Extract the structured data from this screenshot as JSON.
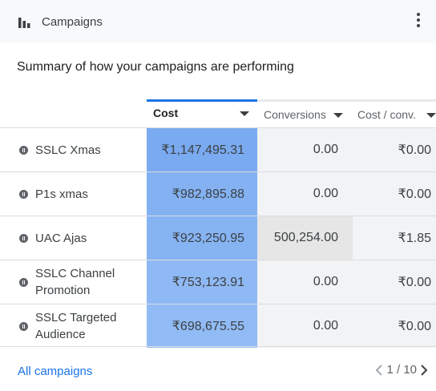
{
  "header": {
    "title": "Campaigns",
    "menu_icon": "more-vert-icon",
    "chart_icon": "bar-chart-icon"
  },
  "summary_text": "Summary of how your campaigns are performing",
  "columns": [
    {
      "label": "Cost",
      "active": true
    },
    {
      "label": "Conversions",
      "active": false
    },
    {
      "label": "Cost / conv.",
      "active": false
    }
  ],
  "rows": [
    {
      "name": "SSLC Xmas",
      "cost": "₹1,147,495.31",
      "conversions": "0.00",
      "cost_per_conv": "₹0.00",
      "status_icon": "paused-icon"
    },
    {
      "name": "P1s xmas",
      "cost": "₹982,895.88",
      "conversions": "0.00",
      "cost_per_conv": "₹0.00",
      "status_icon": "paused-icon"
    },
    {
      "name": "UAC Ajas",
      "cost": "₹923,250.95",
      "conversions": "500,254.00",
      "cost_per_conv": "₹1.85",
      "status_icon": "paused-icon"
    },
    {
      "name": "SSLC Channel Promotion",
      "cost": "₹753,123.91",
      "conversions": "0.00",
      "cost_per_conv": "₹0.00",
      "status_icon": "paused-icon"
    },
    {
      "name": "SSLC Targeted Audience",
      "cost": "₹698,675.55",
      "conversions": "0.00",
      "cost_per_conv": "₹0.00",
      "status_icon": "paused-icon"
    }
  ],
  "footer": {
    "all_campaigns": "All campaigns",
    "pagination": "1 / 10"
  },
  "colors": {
    "cost_scale": [
      "#7aaaf0",
      "#83b1f2",
      "#86b3f2",
      "#8fb9f4",
      "#91bbf4"
    ],
    "conversion_highlight": "#e6e6e6",
    "neutral_cell": "#f1f3f4",
    "accent": "#1a73e8"
  }
}
